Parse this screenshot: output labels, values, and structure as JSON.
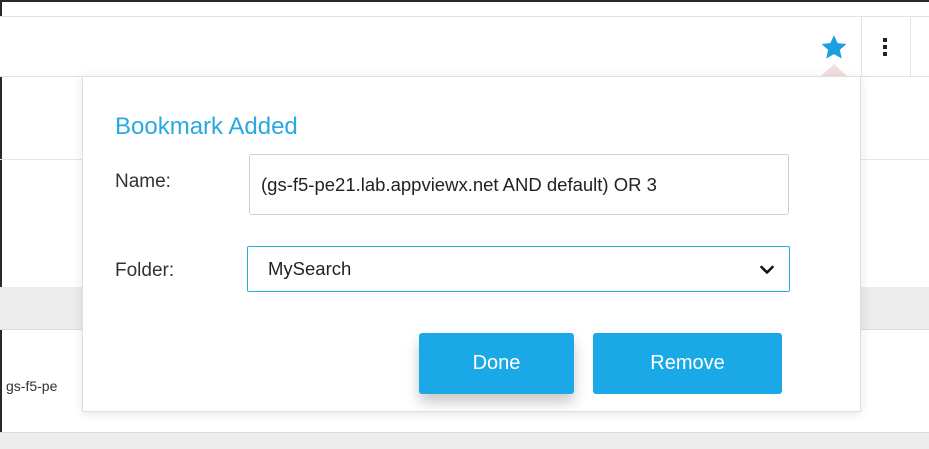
{
  "toolbar": {
    "bookmark_icon": "star-icon",
    "more_icon": "more-vertical-icon",
    "accent_color": "#29a9e1"
  },
  "background": {
    "row_cell_text": "gs-f5-pe"
  },
  "bookmark_popup": {
    "title": "Bookmark Added",
    "name_label": "Name:",
    "name_value": "(gs-f5-pe21.lab.appviewx.net AND default) OR 3",
    "folder_label": "Folder:",
    "folder_options": [
      "MySearch"
    ],
    "folder_selected": "MySearch",
    "done_label": "Done",
    "remove_label": "Remove",
    "button_color": "#1aa9e6"
  }
}
